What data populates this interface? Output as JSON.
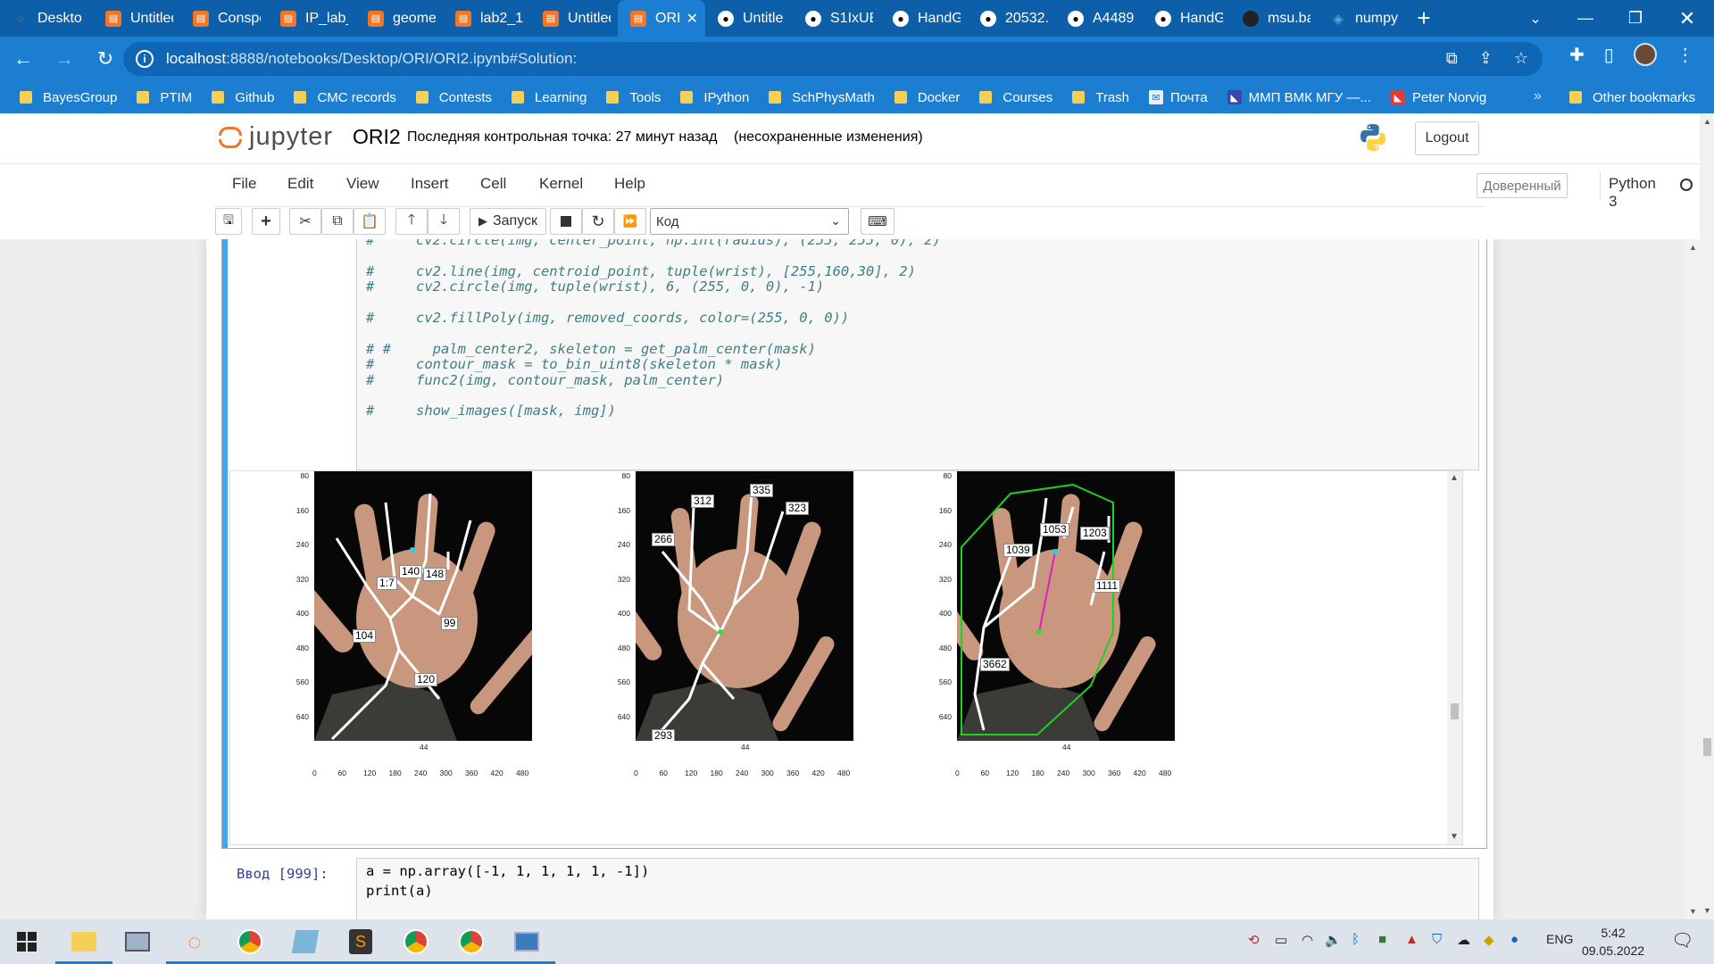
{
  "browser": {
    "tabs": [
      {
        "title": "Deskto",
        "icon": "jupyter-logo-icon",
        "active": false
      },
      {
        "title": "Untitled",
        "icon": "jupyter-notebook-icon",
        "active": false
      },
      {
        "title": "Conspe",
        "icon": "jupyter-notebook-icon",
        "active": false
      },
      {
        "title": "IP_lab_",
        "icon": "jupyter-notebook-icon",
        "active": false
      },
      {
        "title": "geome",
        "icon": "jupyter-notebook-icon",
        "active": false
      },
      {
        "title": "lab2_1",
        "icon": "jupyter-notebook-icon",
        "active": false
      },
      {
        "title": "Untitled",
        "icon": "jupyter-notebook-icon",
        "active": false
      },
      {
        "title": "ORI",
        "icon": "jupyter-notebook-icon",
        "active": true
      },
      {
        "title": "Untitle",
        "icon": "github-icon",
        "active": false
      },
      {
        "title": "S1IxUE",
        "icon": "github-icon",
        "active": false
      },
      {
        "title": "HandG",
        "icon": "github-icon",
        "active": false
      },
      {
        "title": "20532.",
        "icon": "github-icon",
        "active": false
      },
      {
        "title": "A4489",
        "icon": "github-icon",
        "active": false
      },
      {
        "title": "HandG",
        "icon": "github-icon",
        "active": false
      },
      {
        "title": "msu.ba",
        "icon": "dark-circle-icon",
        "active": false
      },
      {
        "title": "numpy",
        "icon": "numpy-icon",
        "active": false
      }
    ],
    "address": {
      "host": "localhost",
      "path": ":8888/notebooks/Desktop/ORI/ORI2.ipynb#Solution:"
    },
    "bookmarks": [
      {
        "label": "BayesGroup",
        "type": "folder"
      },
      {
        "label": "PTIM",
        "type": "folder"
      },
      {
        "label": "Github",
        "type": "folder"
      },
      {
        "label": "CMC records",
        "type": "folder"
      },
      {
        "label": "Contests",
        "type": "folder"
      },
      {
        "label": "Learning",
        "type": "folder"
      },
      {
        "label": "Tools",
        "type": "folder"
      },
      {
        "label": "IPython",
        "type": "folder"
      },
      {
        "label": "SchPhysMath",
        "type": "folder"
      },
      {
        "label": "Docker",
        "type": "folder"
      },
      {
        "label": "Courses",
        "type": "folder"
      },
      {
        "label": "Trash",
        "type": "folder"
      },
      {
        "label": "Почта",
        "type": "mail"
      },
      {
        "label": "ММП ВМК МГУ —...",
        "type": "site"
      },
      {
        "label": "Peter Norvig",
        "type": "site"
      }
    ],
    "bookmarks_more": "»",
    "other_bookmarks": "Other bookmarks"
  },
  "jupyter": {
    "logo_text": "jupyter",
    "notebook_name": "ORI2",
    "checkpoint": "Последняя контрольная точка: 27 минут назад",
    "unsaved": "(несохраненные изменения)",
    "logout": "Logout",
    "menu": [
      "File",
      "Edit",
      "View",
      "Insert",
      "Cell",
      "Kernel",
      "Help"
    ],
    "trusted": "Доверенный",
    "kernel": "Python 3",
    "run_label": "Запуск",
    "cell_type": "Код"
  },
  "cell": {
    "code_lines": [
      "#     cv2.circle(img, center_point, np.int(radius), (255, 255, 0), 2)",
      "",
      "#     cv2.line(img, centroid_point, tuple(wrist), [255,160,30], 2)",
      "#     cv2.circle(img, tuple(wrist), 6, (255, 0, 0), -1)",
      "",
      "#     cv2.fillPoly(img, removed_coords, color=(255, 0, 0))",
      "",
      "# #     palm_center2, skeleton = get_palm_center(mask)",
      "#     contour_mask = to_bin_uint8(skeleton * mask)",
      "#     func2(img, contour_mask, palm_center)",
      "",
      "#     show_images([mask, img])"
    ]
  },
  "output": {
    "y_ticks": [
      "80",
      "160",
      "240",
      "320",
      "400",
      "480",
      "560",
      "640"
    ],
    "x_ticks": [
      "0",
      "60",
      "120",
      "180",
      "240",
      "300",
      "360",
      "420",
      "480"
    ],
    "x_mid_label": "44",
    "panels": [
      {
        "labels": [
          "1:7",
          "140",
          "148",
          "99",
          "104",
          "120"
        ]
      },
      {
        "labels": [
          "312",
          "335",
          "323",
          "266",
          "293"
        ]
      },
      {
        "labels": [
          "1053",
          "1203",
          "1039",
          "1111",
          "3662"
        ]
      }
    ]
  },
  "next_cell": {
    "prompt": "Ввод [999]:",
    "lines": [
      "a = np.array([-1, 1, 1, 1, 1, -1])",
      "print(a)"
    ]
  },
  "taskbar": {
    "lang": "ENG",
    "time": "5:42",
    "date": "09.05.2022"
  }
}
